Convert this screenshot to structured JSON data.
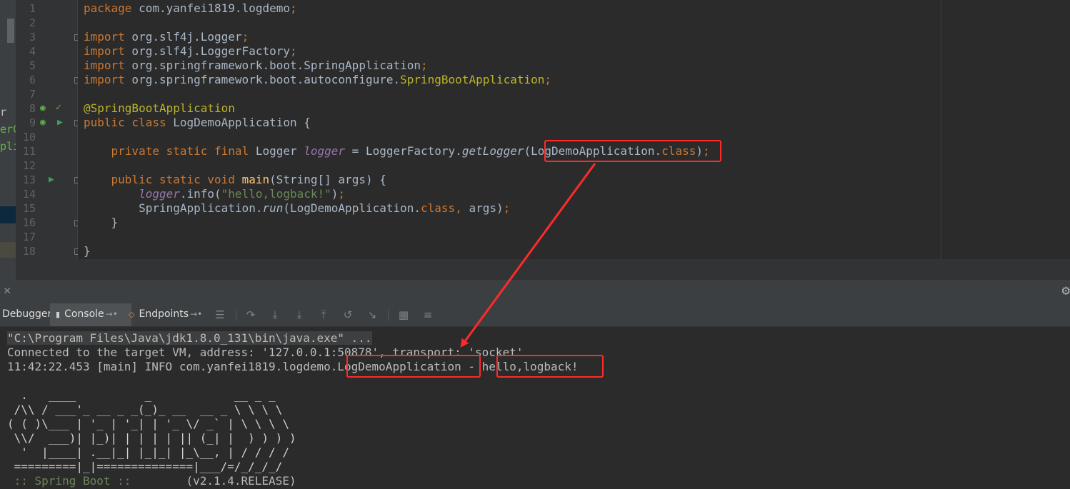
{
  "editor": {
    "line_numbers": [
      "1",
      "2",
      "3",
      "4",
      "5",
      "6",
      "7",
      "8",
      "9",
      "10",
      "11",
      "12",
      "13",
      "14",
      "15",
      "16",
      "17",
      "18"
    ],
    "code": {
      "l1_kw": "package",
      "l1_rest": " com.yanfei1819.logdemo",
      "semi": ";",
      "import_kw": "import",
      "l3_rest": " org.slf4j.Logger",
      "l4_rest": " org.slf4j.LoggerFactory",
      "l5_rest": " org.springframework.boot.SpringApplication",
      "l6_rest": " org.springframework.boot.autoconfigure.",
      "l6_ann": "SpringBootApplication",
      "l8_ann": "@SpringBootApplication",
      "l9_kw": "public class",
      "l9_rest": " LogDemoApplication {",
      "l11_indent": "    ",
      "l11_kw": "private static final",
      "l11_type": " Logger ",
      "l11_field": "logger",
      "l11_eq": " = LoggerFactory.",
      "l11_method": "getLogger",
      "l11_arg": "(LogDemoApplication.",
      "class_kw": "class",
      "l11_end": ")",
      "l13_indent": "    ",
      "l13_kw": "public static void",
      "l13_space": " ",
      "l13_fn": "main",
      "l13_rest": "(String[] args) {",
      "l14_indent": "        ",
      "l14_field": "logger",
      "l14_mid": ".info(",
      "l14_str": "\"hello,logback!\"",
      "l14_end": ")",
      "l15_indent": "        ",
      "l15_a": "SpringApplication.",
      "l15_run": "run",
      "l15_b": "(LogDemoApplication.",
      "l15_comma": ",",
      "l15_c": " args)",
      "l16": "    }",
      "l18": "}"
    }
  },
  "left_panel_fragments": [
    "r",
    "erCo",
    "plic"
  ],
  "tool_window": {
    "tabs": [
      {
        "label": "Debugger",
        "active": false
      },
      {
        "label": "Console",
        "active": true
      },
      {
        "label": "Endpoints",
        "active": false
      }
    ],
    "pin_glyph": "→•",
    "toolbar_icons": [
      "menu-icon",
      "step-over-icon",
      "step-into-icon",
      "force-step-into-icon",
      "step-out-icon",
      "drop-frame-icon",
      "run-to-cursor-icon",
      "evaluate-icon",
      "trace-icon"
    ]
  },
  "console": {
    "cmd": "\"C:\\Program Files\\Java\\jdk1.8.0_131\\bin\\java.exe\" ...",
    "connected": "Connected to the target VM, address: '127.0.0.1:50878', transport: 'socket'",
    "log_prefix": "11:42:22.453 [main] INFO com.yanfei1819.logdemo.",
    "log_class": "LogDemoApplication",
    "log_sep": " - ",
    "log_msg": "hello,logback!",
    "banner": [
      "  .   ____          _            __ _ _",
      " /\\\\ / ___'_ __ _ _(_)_ __  __ _ \\ \\ \\ \\",
      "( ( )\\___ | '_ | '_| | '_ \\/ _` | \\ \\ \\ \\",
      " \\\\/  ___)| |_)| | | | | || (_| |  ) ) ) )",
      "  '  |____| .__|_| |_|_| |_\\__, | / / / /",
      " =========|_|==============|___/=/_/_/_/"
    ],
    "boot_label": " :: Spring Boot :: ",
    "boot_version": "       (v2.1.4.RELEASE)"
  },
  "colors": {
    "editor_bg": "#2b2b2b",
    "keyword": "#cc7832",
    "annotation": "#bbb529",
    "string": "#6a8759",
    "field": "#9876aa",
    "method_decl": "#ffc66d",
    "annotation_box": "#ff2a2a"
  }
}
